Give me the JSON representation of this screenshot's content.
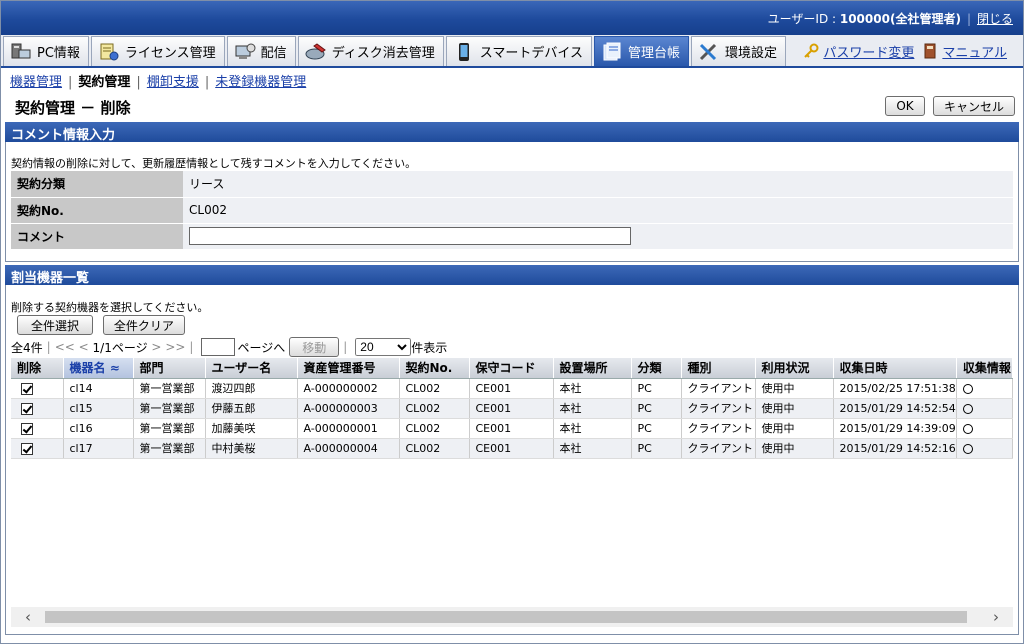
{
  "header": {
    "user_prefix": "ユーザーID : ",
    "user_id": "100000(全社管理者)",
    "close_label": "閉じる"
  },
  "tabs": [
    {
      "label": "PC情報",
      "icon": "pc-icon"
    },
    {
      "label": "ライセンス管理",
      "icon": "license-icon"
    },
    {
      "label": "配信",
      "icon": "distribution-icon"
    },
    {
      "label": "ディスク消去管理",
      "icon": "disk-erase-icon"
    },
    {
      "label": "スマートデバイス",
      "icon": "smartphone-icon"
    },
    {
      "label": "管理台帳",
      "icon": "ledger-icon",
      "active": true
    },
    {
      "label": "環境設定",
      "icon": "tools-icon"
    }
  ],
  "tab_links": {
    "password_label": "パスワード変更",
    "manual_label": "マニュアル"
  },
  "subnav": {
    "items": [
      "機器管理",
      "契約管理",
      "棚卸支援",
      "未登録機器管理"
    ]
  },
  "page": {
    "title": "契約管理 － 削除",
    "ok_label": "OK",
    "cancel_label": "キャンセル"
  },
  "comment_section": {
    "title": "コメント情報入力",
    "note": "契約情報の削除に対して、更新履歴情報として残すコメントを入力してください。",
    "rows": [
      {
        "label": "契約分類",
        "value": "リース"
      },
      {
        "label": "契約No.",
        "value": "CL002"
      },
      {
        "label": "コメント",
        "value": ""
      }
    ]
  },
  "device_section": {
    "title": "割当機器一覧",
    "note": "削除する契約機器を選択してください。",
    "select_all_label": "全件選択",
    "clear_all_label": "全件クリア",
    "pager": {
      "count": "全4件",
      "first": "<<",
      "prev": "<",
      "page": "1/1ページ",
      "next": ">",
      "last": ">>",
      "goto_label": "ページへ",
      "move_label": "移動",
      "per_page": "20",
      "per_page_suffix": "件表示"
    },
    "columns": [
      "削除",
      "機器名",
      "部門",
      "ユーザー名",
      "資産管理番号",
      "契約No.",
      "保守コード",
      "設置場所",
      "分類",
      "種別",
      "利用状況",
      "収集日時",
      "収集情報"
    ],
    "sorted_column": "機器名",
    "rows": [
      {
        "checked": true,
        "device": "cl14",
        "dept": "第一営業部",
        "user": "渡辺四郎",
        "asset": "A-000000002",
        "contract": "CL002",
        "maint": "CE001",
        "location": "本社",
        "class": "PC",
        "type": "クライアント",
        "status": "使用中",
        "collected": "2015/02/25 17:51:38"
      },
      {
        "checked": true,
        "device": "cl15",
        "dept": "第一営業部",
        "user": "伊藤五郎",
        "asset": "A-000000003",
        "contract": "CL002",
        "maint": "CE001",
        "location": "本社",
        "class": "PC",
        "type": "クライアント",
        "status": "使用中",
        "collected": "2015/01/29 14:52:54"
      },
      {
        "checked": true,
        "device": "cl16",
        "dept": "第一営業部",
        "user": "加藤美咲",
        "asset": "A-000000001",
        "contract": "CL002",
        "maint": "CE001",
        "location": "本社",
        "class": "PC",
        "type": "クライアント",
        "status": "使用中",
        "collected": "2015/01/29 14:39:09"
      },
      {
        "checked": true,
        "device": "cl17",
        "dept": "第一営業部",
        "user": "中村美桜",
        "asset": "A-000000004",
        "contract": "CL002",
        "maint": "CE001",
        "location": "本社",
        "class": "PC",
        "type": "クライアント",
        "status": "使用中",
        "collected": "2015/01/29 14:52:16"
      }
    ]
  },
  "colors": {
    "header_blue": "#1e4a9c",
    "link_blue": "#1a3fa8"
  }
}
